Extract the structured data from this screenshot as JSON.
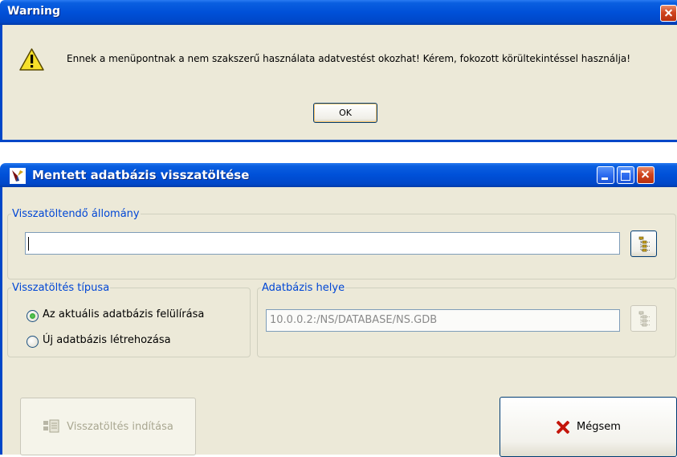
{
  "warning": {
    "title": "Warning",
    "message": "Ennek a menüpontnak a nem szakszerű használata adatvestést okozhat! Kérem, fokozott körültekintéssel használja!",
    "ok_label": "OK",
    "icon": "warning-triangle-icon"
  },
  "restore_window": {
    "title": "Mentett adatbázis visszatöltése",
    "file_group": {
      "legend": "Visszatöltendő állomány",
      "value": "",
      "browse_icon": "folder-tree-icon"
    },
    "type_group": {
      "legend": "Visszatöltés típusa",
      "options": [
        {
          "label": "Az aktuális adatbázis felülírása",
          "selected": true
        },
        {
          "label": "Új adatbázis létrehozása",
          "selected": false
        }
      ]
    },
    "location_group": {
      "legend": "Adatbázis helye",
      "value": "10.0.0.2:/NS/DATABASE/NS.GDB",
      "browse_icon": "folder-tree-icon"
    },
    "start_label": "Visszatöltés indítása",
    "cancel_label": "Mégsem"
  },
  "colors": {
    "titlebar": "#0050d8",
    "window_bg": "#ece9d8",
    "legend": "#0046d5",
    "disabled_text": "#a9a791"
  }
}
